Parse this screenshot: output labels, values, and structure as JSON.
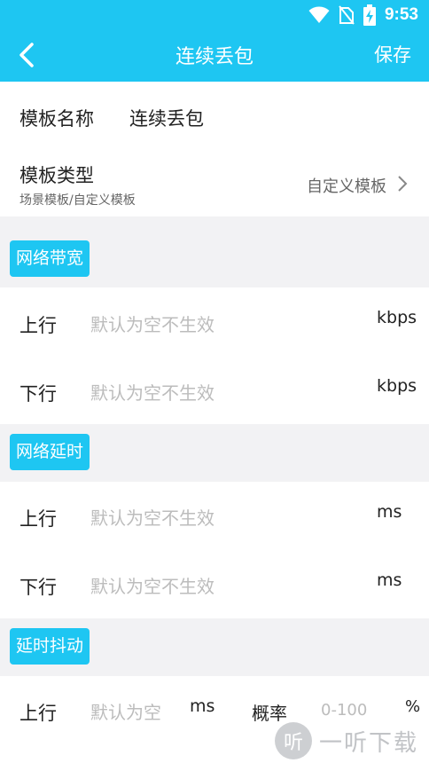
{
  "status": {
    "time": "9:53"
  },
  "header": {
    "title": "连续丢包",
    "save_label": "保存"
  },
  "template_name": {
    "label": "模板名称",
    "value": "连续丢包"
  },
  "template_type": {
    "label": "模板类型",
    "sub": "场景模板/自定义模板",
    "value": "自定义模板"
  },
  "sections": [
    {
      "title": "网络带宽",
      "rows": [
        {
          "label": "上行",
          "placeholder": "默认为空不生效",
          "unit": "kbps"
        },
        {
          "label": "下行",
          "placeholder": "默认为空不生效",
          "unit": "kbps"
        }
      ]
    },
    {
      "title": "网络延时",
      "rows": [
        {
          "label": "上行",
          "placeholder": "默认为空不生效",
          "unit": "ms"
        },
        {
          "label": "下行",
          "placeholder": "默认为空不生效",
          "unit": "ms"
        }
      ]
    },
    {
      "title": "延时抖动",
      "row": {
        "label": "上行",
        "placeholder": "默认为空",
        "unit": "ms",
        "prob_label": "概率",
        "prob_placeholder": "0-100",
        "prob_unit": "%"
      }
    }
  ],
  "watermark": {
    "text": "一听下载",
    "icon_char": "听"
  },
  "colors": {
    "accent": "#1ec6f2",
    "section_bg": "#f2f2f4",
    "hint": "#bcbcbc"
  }
}
